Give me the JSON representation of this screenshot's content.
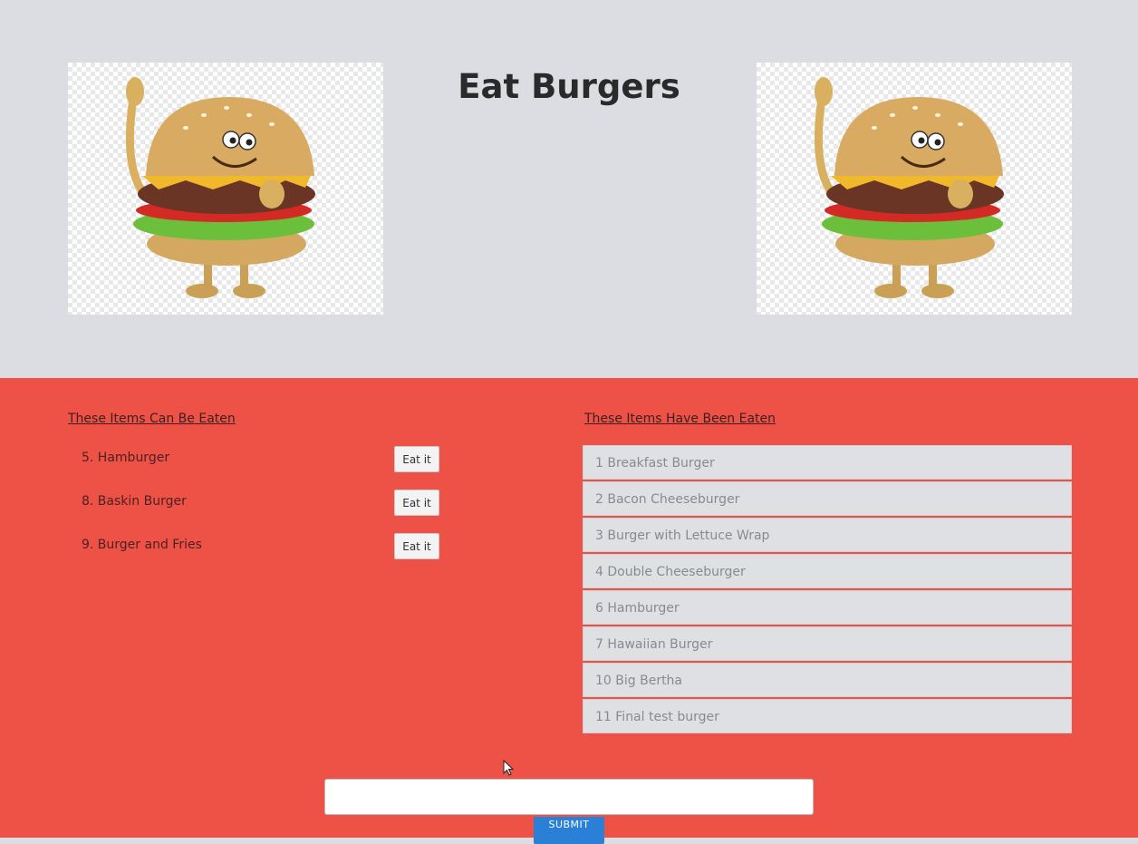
{
  "page": {
    "title": "Eat Burgers"
  },
  "uneaten": {
    "heading": "These Items Can Be Eaten",
    "items": [
      {
        "label": "5. Hamburger",
        "button": "Eat it"
      },
      {
        "label": "8. Baskin Burger",
        "button": "Eat it"
      },
      {
        "label": "9. Burger and Fries",
        "button": "Eat it"
      }
    ]
  },
  "eaten": {
    "heading": "These Items Have Been Eaten",
    "items": [
      "1 Breakfast Burger",
      "2 Bacon Cheeseburger",
      "3 Burger with Lettuce Wrap",
      "4 Double Cheeseburger",
      "6 Hamburger",
      "7 Hawaiian Burger",
      "10 Big Bertha",
      "11 Final test burger"
    ]
  },
  "form": {
    "input_value": "",
    "input_placeholder": "",
    "submit_label": "SUBMIT"
  },
  "colors": {
    "header_bg": "#dcdde3",
    "main_bg": "#ee5145",
    "submit_bg": "#2a7fd6"
  },
  "icons": {
    "burger_image": "waving-cartoon-burger-image",
    "cursor": "mouse-pointer-icon"
  }
}
